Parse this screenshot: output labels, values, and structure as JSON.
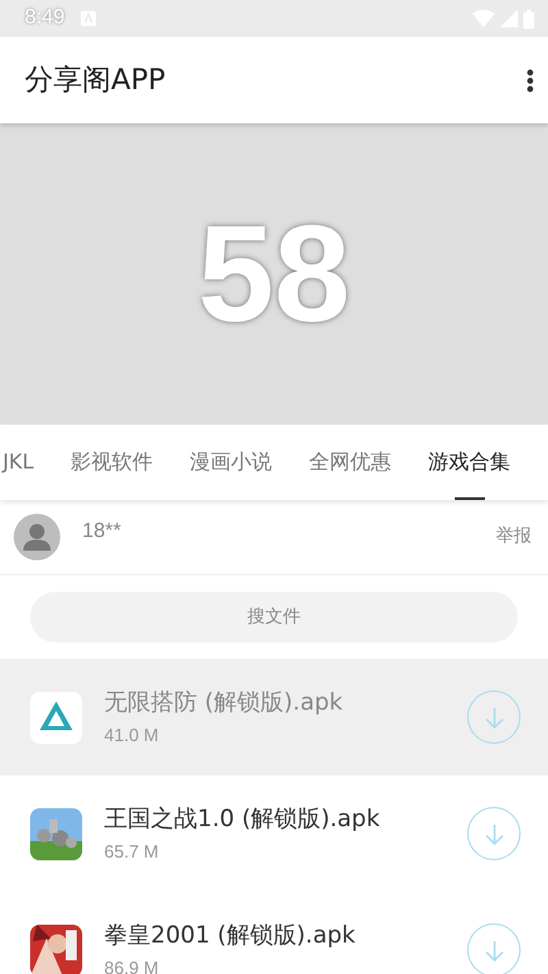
{
  "status_bar": {
    "time": "8:49"
  },
  "app_bar": {
    "title": "分享阁APP"
  },
  "banner": {
    "text": "58"
  },
  "tabs": [
    {
      "label": "JKL",
      "selected": false
    },
    {
      "label": "影视软件",
      "selected": false
    },
    {
      "label": "漫画小说",
      "selected": false
    },
    {
      "label": "全网优惠",
      "selected": false
    },
    {
      "label": "游戏合集",
      "selected": true
    }
  ],
  "user": {
    "name": "18**",
    "report": "举报"
  },
  "search": {
    "label": "搜文件"
  },
  "files": [
    {
      "name": "无限搭防 (解锁版).apk",
      "size": "41.0 M",
      "selected": true,
      "kind": "logo"
    },
    {
      "name": "王国之战1.0 (解锁版).apk",
      "size": "65.7 M",
      "selected": false,
      "kind": "picture"
    },
    {
      "name": "拳皇2001 (解锁版).apk",
      "size": "86.9 M",
      "selected": false,
      "kind": "picture"
    }
  ]
}
